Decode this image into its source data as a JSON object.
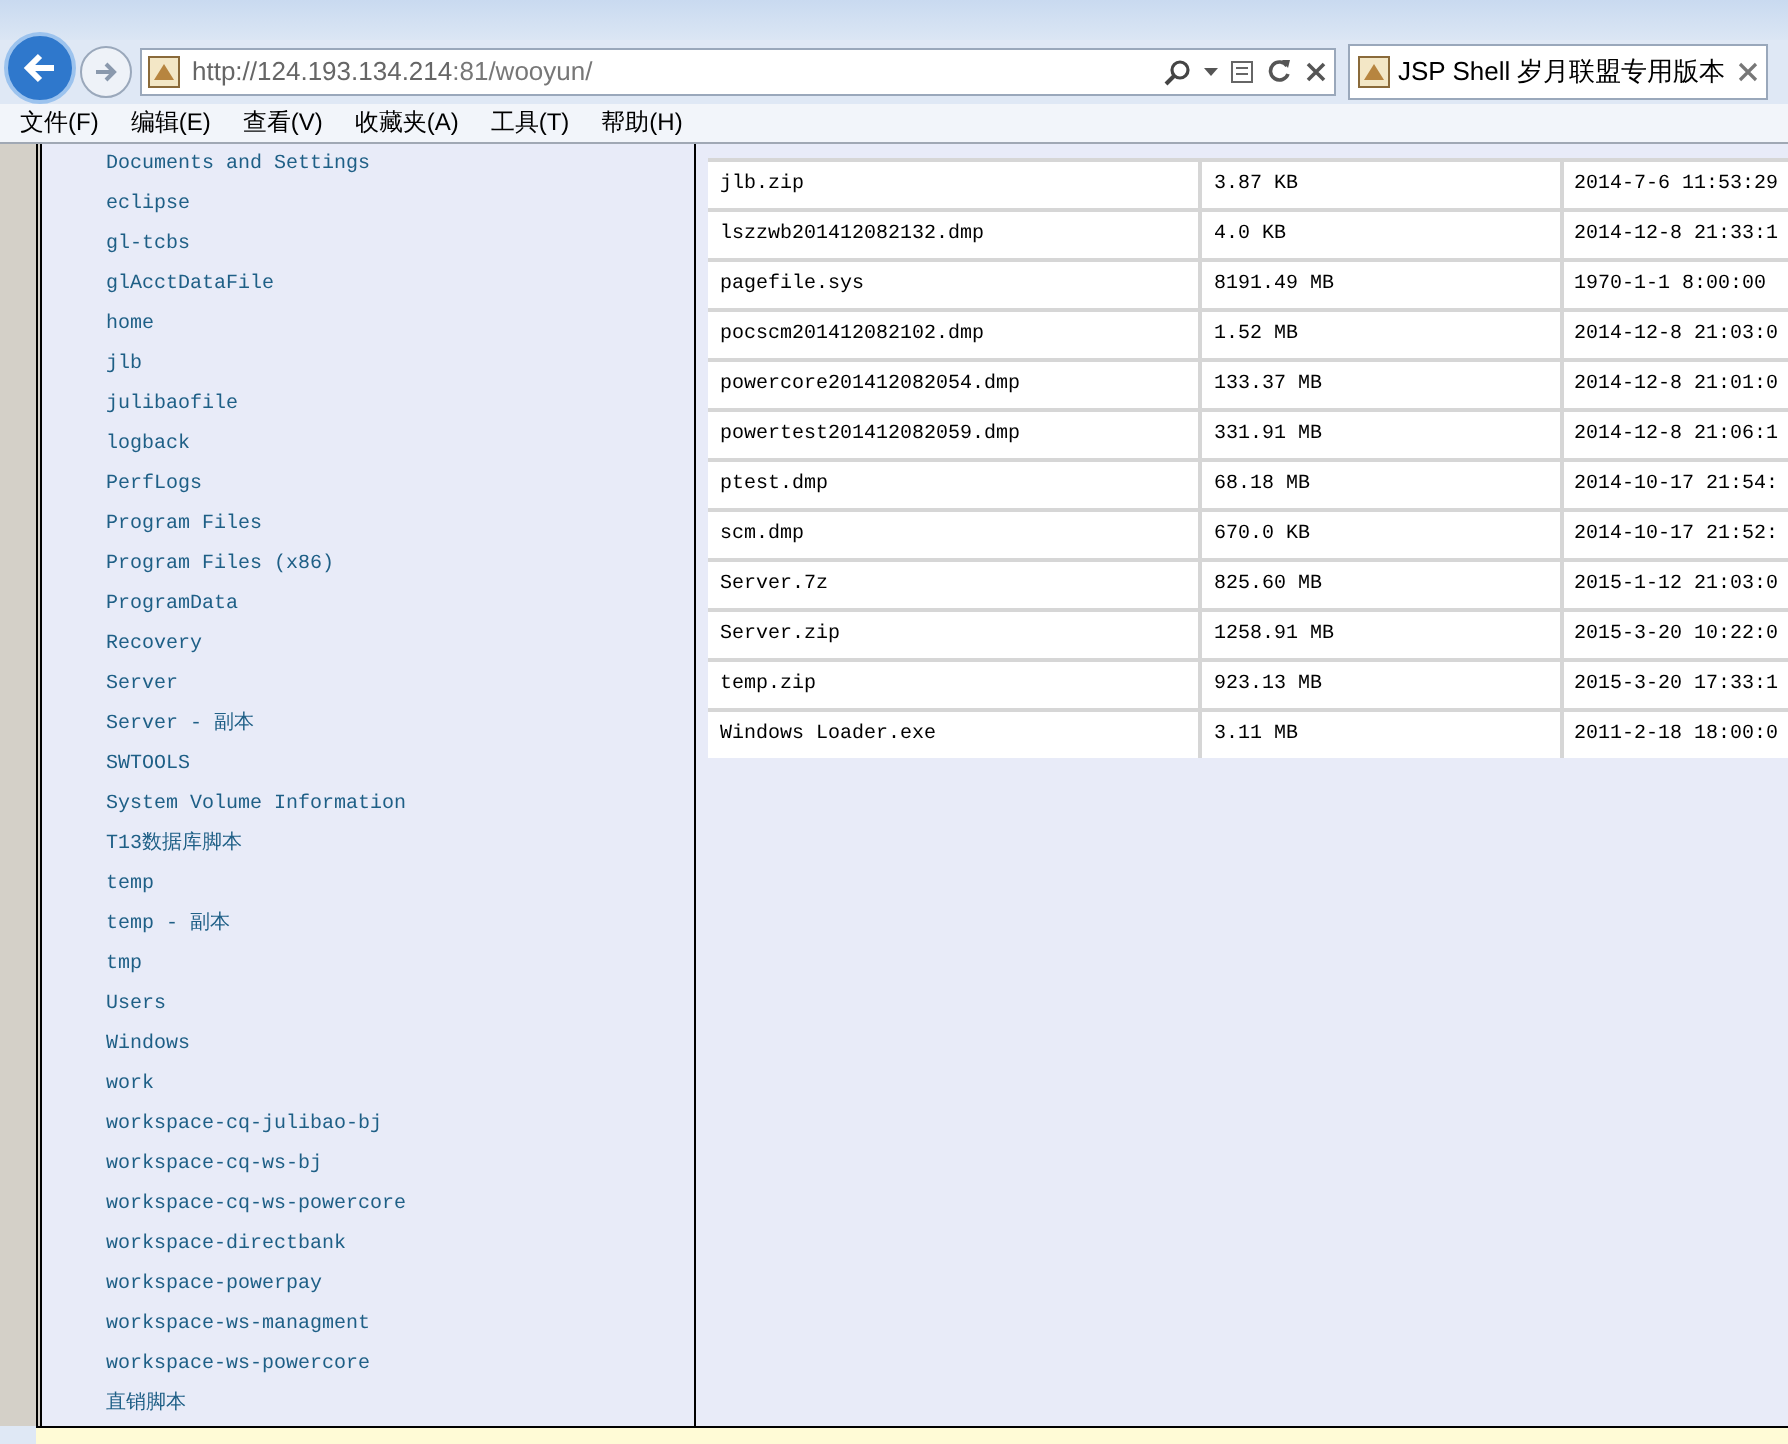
{
  "address_bar": {
    "url_host": "http://124.193.134.214",
    "url_rest": ":81/wooyun/"
  },
  "tab": {
    "title": "JSP Shell 岁月联盟专用版本"
  },
  "menu": [
    "文件(F)",
    "编辑(E)",
    "查看(V)",
    "收藏夹(A)",
    "工具(T)",
    "帮助(H)"
  ],
  "folders": [
    "Documents and Settings",
    "eclipse",
    "gl-tcbs",
    "glAcctDataFile",
    "home",
    "jlb",
    "julibaofile",
    "logback",
    "PerfLogs",
    "Program Files",
    "Program Files (x86)",
    "ProgramData",
    "Recovery",
    "Server",
    "Server - 副本",
    "SWTOOLS",
    "System Volume Information",
    "T13数据库脚本",
    "temp",
    "temp - 副本",
    "tmp",
    "Users",
    "Windows",
    "work",
    "workspace-cq-julibao-bj",
    "workspace-cq-ws-bj",
    "workspace-cq-ws-powercore",
    "workspace-directbank",
    "workspace-powerpay",
    "workspace-ws-managment",
    "workspace-ws-powercore",
    "直销脚本"
  ],
  "files": [
    {
      "name": "jlb.zip",
      "size": "3.87 KB",
      "modified": "2014-7-6 11:53:29"
    },
    {
      "name": "lszzwb201412082132.dmp",
      "size": "4.0 KB",
      "modified": "2014-12-8 21:33:1"
    },
    {
      "name": "pagefile.sys",
      "size": "8191.49 MB",
      "modified": "1970-1-1 8:00:00"
    },
    {
      "name": "pocscm201412082102.dmp",
      "size": "1.52 MB",
      "modified": "2014-12-8 21:03:0"
    },
    {
      "name": "powercore201412082054.dmp",
      "size": "133.37 MB",
      "modified": "2014-12-8 21:01:0"
    },
    {
      "name": "powertest201412082059.dmp",
      "size": "331.91 MB",
      "modified": "2014-12-8 21:06:1"
    },
    {
      "name": "ptest.dmp",
      "size": "68.18 MB",
      "modified": "2014-10-17 21:54:"
    },
    {
      "name": "scm.dmp",
      "size": "670.0 KB",
      "modified": "2014-10-17 21:52:"
    },
    {
      "name": "Server.7z",
      "size": "825.60 MB",
      "modified": "2015-1-12 21:03:0"
    },
    {
      "name": "Server.zip",
      "size": "1258.91 MB",
      "modified": "2015-3-20 10:22:0"
    },
    {
      "name": "temp.zip",
      "size": "923.13 MB",
      "modified": "2015-3-20 17:33:1"
    },
    {
      "name": "Windows Loader.exe",
      "size": "3.11 MB",
      "modified": "2011-2-18 18:00:0"
    }
  ]
}
